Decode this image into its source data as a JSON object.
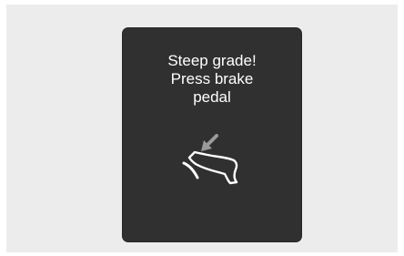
{
  "warning": {
    "lines": [
      "Steep grade!",
      "Press brake",
      "pedal"
    ],
    "icon": "brake-pedal-icon"
  },
  "colors": {
    "background": "#ececec",
    "display": "#303030",
    "text": "#ffffff",
    "arrow": "#9a9a9a"
  }
}
